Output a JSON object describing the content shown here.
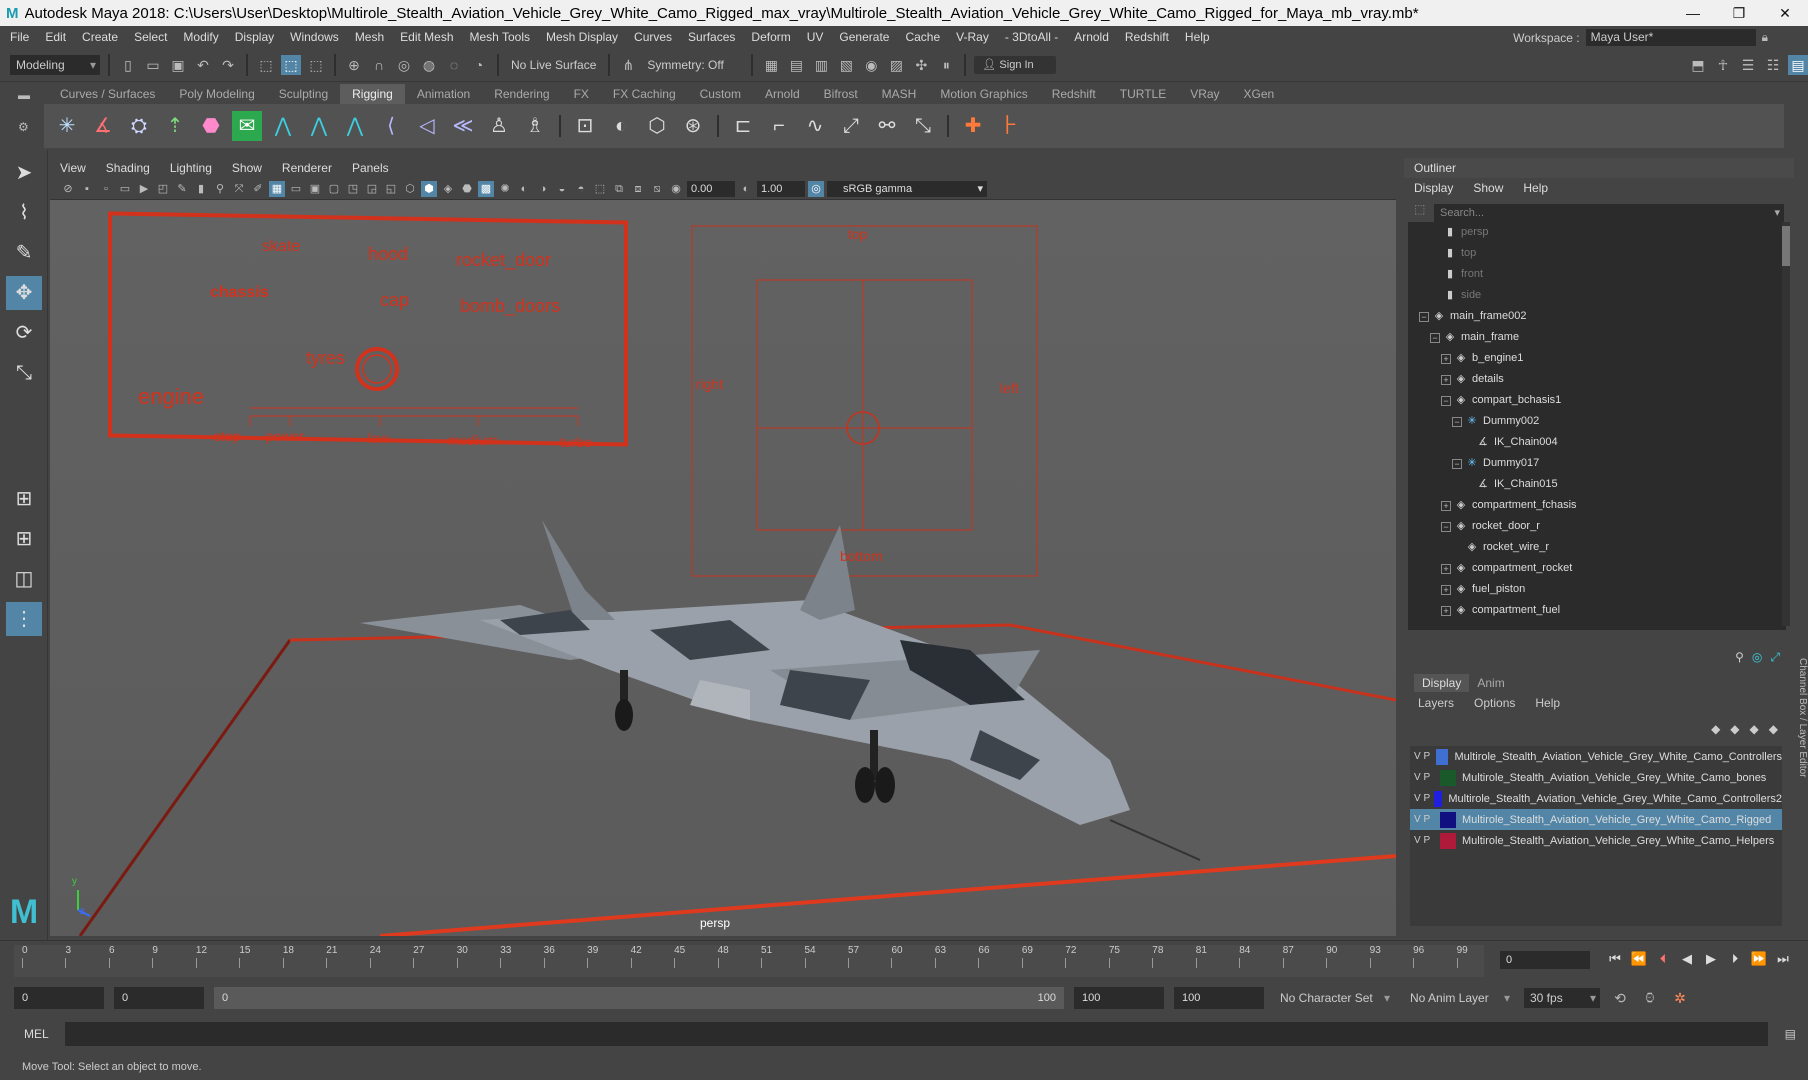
{
  "window": {
    "title": "Autodesk Maya 2018: C:\\Users\\User\\Desktop\\Multirole_Stealth_Aviation_Vehicle_Grey_White_Camo_Rigged_max_vray\\Multirole_Stealth_Aviation_Vehicle_Grey_White_Camo_Rigged_for_Maya_mb_vray.mb*",
    "minimize": "—",
    "maximize": "❐",
    "close": "✕"
  },
  "menu": [
    "File",
    "Edit",
    "Create",
    "Select",
    "Modify",
    "Display",
    "Windows",
    "Mesh",
    "Edit Mesh",
    "Mesh Tools",
    "Mesh Display",
    "Curves",
    "Surfaces",
    "Deform",
    "UV",
    "Generate",
    "Cache",
    "V-Ray",
    "- 3DtoAll -",
    "Arnold",
    "Redshift",
    "Help"
  ],
  "workspace": {
    "label": "Workspace :",
    "value": "Maya User*"
  },
  "status": {
    "mode": "Modeling",
    "live_surface": "No Live Surface",
    "symmetry": "Symmetry: Off",
    "sign_in": "Sign In"
  },
  "shelf_tabs": [
    "Curves / Surfaces",
    "Poly Modeling",
    "Sculpting",
    "Rigging",
    "Animation",
    "Rendering",
    "FX",
    "FX Caching",
    "Custom",
    "Arnold",
    "Bifrost",
    "MASH",
    "Motion Graphics",
    "Redshift",
    "TURTLE",
    "VRay",
    "XGen"
  ],
  "panel_menu": [
    "View",
    "Shading",
    "Lighting",
    "Show",
    "Renderer",
    "Panels"
  ],
  "panel_fields": {
    "exposure": "0.00",
    "gamma": "1.00",
    "colorspace": "sRGB gamma"
  },
  "viewport": {
    "camera": "persp",
    "axis_y": "y",
    "axis_z": "z",
    "control_labels": {
      "skate": "skate",
      "hood": "hood",
      "rocket_door": "rocket_door",
      "chassis": "chassis",
      "cap": "cap",
      "bomb_doors": "bomb_doors",
      "tyres": "tyres",
      "engine": "engine",
      "stop": "stop",
      "power": "power",
      "low": "low",
      "medium": "medium",
      "turbo": "turbo",
      "top": "top",
      "right": "right",
      "left": "left",
      "bottom": "bottom"
    }
  },
  "outliner": {
    "title": "Outliner",
    "menu": [
      "Display",
      "Show",
      "Help"
    ],
    "search_placeholder": "Search...",
    "items": [
      {
        "label": "persp",
        "depth": 2,
        "icon": "camera"
      },
      {
        "label": "top",
        "depth": 2,
        "icon": "camera"
      },
      {
        "label": "front",
        "depth": 2,
        "icon": "camera"
      },
      {
        "label": "side",
        "depth": 2,
        "icon": "camera"
      },
      {
        "label": "main_frame002",
        "depth": 1,
        "icon": "transform",
        "toggle": "−"
      },
      {
        "label": "main_frame",
        "depth": 2,
        "icon": "transform",
        "toggle": "−"
      },
      {
        "label": "b_engine1",
        "depth": 3,
        "icon": "transform",
        "toggle": "+"
      },
      {
        "label": "details",
        "depth": 3,
        "icon": "transform",
        "toggle": "+"
      },
      {
        "label": "compart_bchasis1",
        "depth": 3,
        "icon": "transform",
        "toggle": "−"
      },
      {
        "label": "Dummy002",
        "depth": 4,
        "icon": "joint",
        "toggle": "−"
      },
      {
        "label": "IK_Chain004",
        "depth": 5,
        "icon": "ik"
      },
      {
        "label": "Dummy017",
        "depth": 4,
        "icon": "joint",
        "toggle": "−"
      },
      {
        "label": "IK_Chain015",
        "depth": 5,
        "icon": "ik"
      },
      {
        "label": "compartment_fchasis",
        "depth": 3,
        "icon": "transform",
        "toggle": "+"
      },
      {
        "label": "rocket_door_r",
        "depth": 3,
        "icon": "transform",
        "toggle": "−"
      },
      {
        "label": "rocket_wire_r",
        "depth": 4,
        "icon": "transform"
      },
      {
        "label": "compartment_rocket",
        "depth": 3,
        "icon": "transform",
        "toggle": "+"
      },
      {
        "label": "fuel_piston",
        "depth": 3,
        "icon": "transform",
        "toggle": "+"
      },
      {
        "label": "compartment_fuel",
        "depth": 3,
        "icon": "transform",
        "toggle": "+"
      }
    ]
  },
  "layer_editor": {
    "tabs": [
      "Display",
      "Anim"
    ],
    "menu": [
      "Layers",
      "Options",
      "Help"
    ],
    "side_tab": "Channel Box / Layer Editor",
    "layers": [
      {
        "v": "V",
        "p": "P",
        "color": "#3f6fd0",
        "name": "Multirole_Stealth_Aviation_Vehicle_Grey_White_Camo_Controllers",
        "selected": false
      },
      {
        "v": "V",
        "p": "P",
        "color": "#1a5a2a",
        "name": "Multirole_Stealth_Aviation_Vehicle_Grey_White_Camo_bones",
        "selected": false
      },
      {
        "v": "V",
        "p": "P",
        "color": "#1f1fe0",
        "name": "Multirole_Stealth_Aviation_Vehicle_Grey_White_Camo_Controllers2",
        "selected": false
      },
      {
        "v": "V",
        "p": "P",
        "color": "#101080",
        "name": "Multirole_Stealth_Aviation_Vehicle_Grey_White_Camo_Rigged",
        "selected": true
      },
      {
        "v": "V",
        "p": "P",
        "color": "#b01a3a",
        "name": "Multirole_Stealth_Aviation_Vehicle_Grey_White_Camo_Helpers",
        "selected": false
      }
    ]
  },
  "timeline": {
    "ticks": [
      "0",
      "3",
      "6",
      "9",
      "12",
      "15",
      "18",
      "21",
      "24",
      "27",
      "30",
      "33",
      "36",
      "39",
      "42",
      "45",
      "48",
      "51",
      "54",
      "57",
      "60",
      "63",
      "66",
      "69",
      "72",
      "75",
      "78",
      "81",
      "84",
      "87",
      "90",
      "93",
      "96",
      "99"
    ],
    "current_frame": "0",
    "range_start": "0",
    "playback_start": "0",
    "slider_start": "0",
    "slider_end": "100",
    "playback_end": "100",
    "range_end": "100",
    "character_set": "No Character Set",
    "anim_layer": "No Anim Layer",
    "fps": "30 fps"
  },
  "command": {
    "lang": "MEL"
  },
  "help_line": "Move Tool: Select an object to move.",
  "colors": {
    "accent": "#5285a6",
    "control_red": "#d2321c"
  }
}
